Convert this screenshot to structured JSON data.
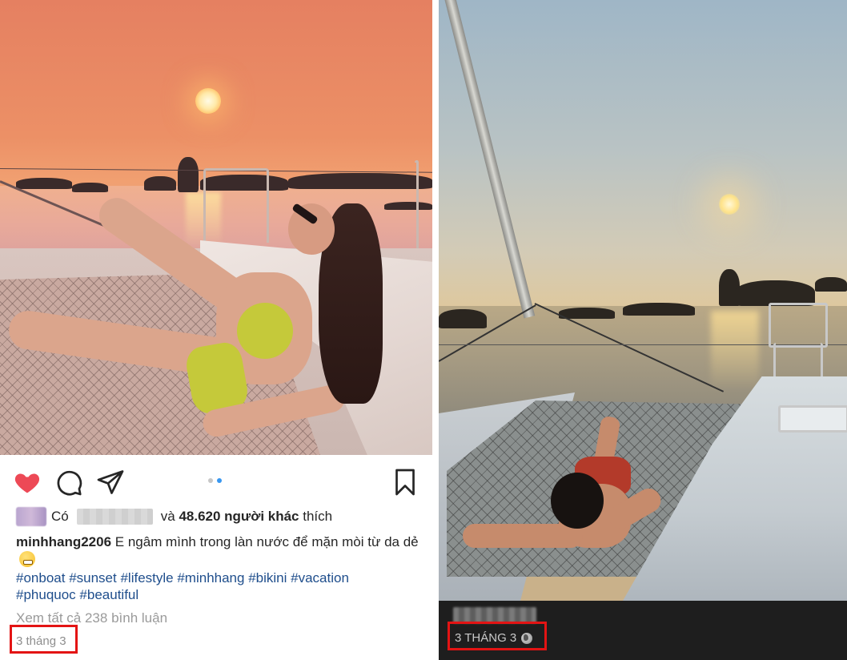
{
  "left_post": {
    "likes": {
      "prefix": "Có",
      "middle": "và",
      "count_text": "48.620 người khác",
      "suffix": "thích"
    },
    "caption": {
      "username": "minhhang2206",
      "text": "E ngâm mình trong làn nước để mặn mòi từ da dẻ"
    },
    "hashtags": [
      "#onboat",
      "#sunset",
      "#lifestyle",
      "#minhhang",
      "#bikini",
      "#vacation",
      "#phuquoc",
      "#beautiful"
    ],
    "view_comments": "Xem tất cả 238 bình luận",
    "date": "3 tháng 3",
    "carousel": {
      "count": 2,
      "active_index": 1
    },
    "colors": {
      "heart": "#ed4956",
      "highlight_box": "#e31414",
      "hashtag": "#1f4e8c"
    },
    "icons": [
      "heart-icon",
      "comment-icon",
      "share-icon",
      "bookmark-icon"
    ]
  },
  "right_post": {
    "date": "3 THÁNG 3",
    "privacy_icon": "globe-icon",
    "colors": {
      "background": "#1e1e1e",
      "highlight_box": "#e31414"
    }
  }
}
